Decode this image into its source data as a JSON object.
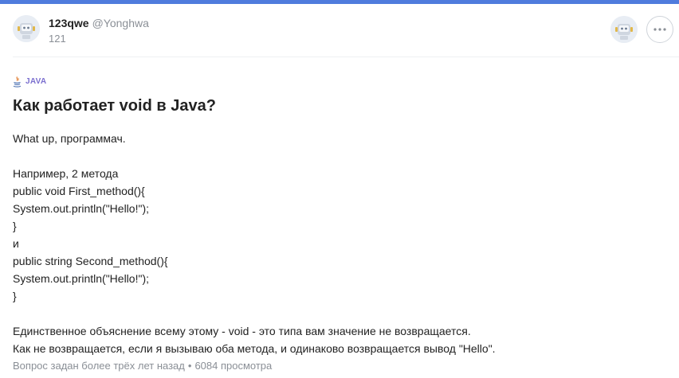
{
  "author": {
    "name": "123qwe",
    "handle": "@Yonghwa",
    "score": "121",
    "avatar_icon": "robot-avatar-icon"
  },
  "tag": {
    "label": "JAVA",
    "icon": "java-icon"
  },
  "question": {
    "title": "Как работает void в Java?",
    "body_lines": [
      "What up, программач.",
      "",
      "Например, 2 метода",
      "public void First_method(){",
      "System.out.println(\"Hello!\");",
      "}",
      "и",
      "public string Second_method(){",
      "System.out.println(\"Hello!\");",
      "}",
      "",
      "Единственное объяснение всему этому - void - это типа вам значение не возвращается.",
      "Как не возвращается, если я вызываю оба метода, и одинаково возвращается вывод \"Hello\"."
    ]
  },
  "footer": {
    "asked": "Вопрос задан более трёх лет назад",
    "separator": "•",
    "views": "6084 просмотра"
  },
  "controls": {
    "more_icon": "more-options-icon"
  },
  "colors": {
    "accent_bar": "#4f7cdd",
    "tag_text": "#7b6fcf",
    "muted_text": "#8a8f96"
  }
}
